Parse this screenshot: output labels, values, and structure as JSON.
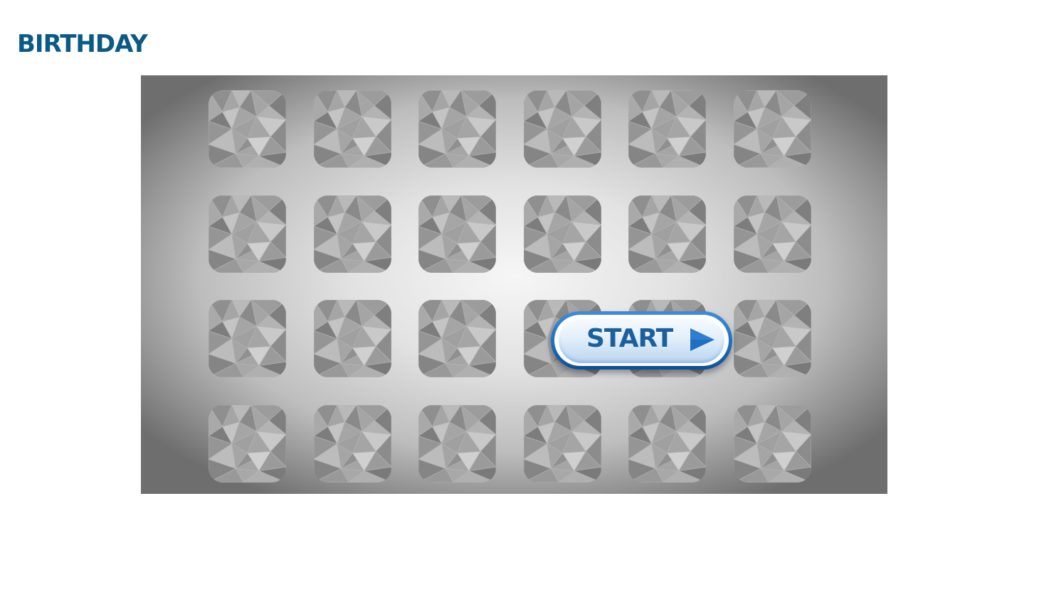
{
  "page": {
    "title": "BIRTHDAY"
  },
  "game": {
    "start_label": "START",
    "start_icon": "play-triangle-icon",
    "grid": {
      "rows": 4,
      "columns": 6,
      "tile_state": "face-down"
    }
  },
  "colors": {
    "title": "#0b5a86",
    "button_border": "#1d6fc2",
    "button_text": "#1a5f9e",
    "tile_back": "#a5a5a5"
  }
}
